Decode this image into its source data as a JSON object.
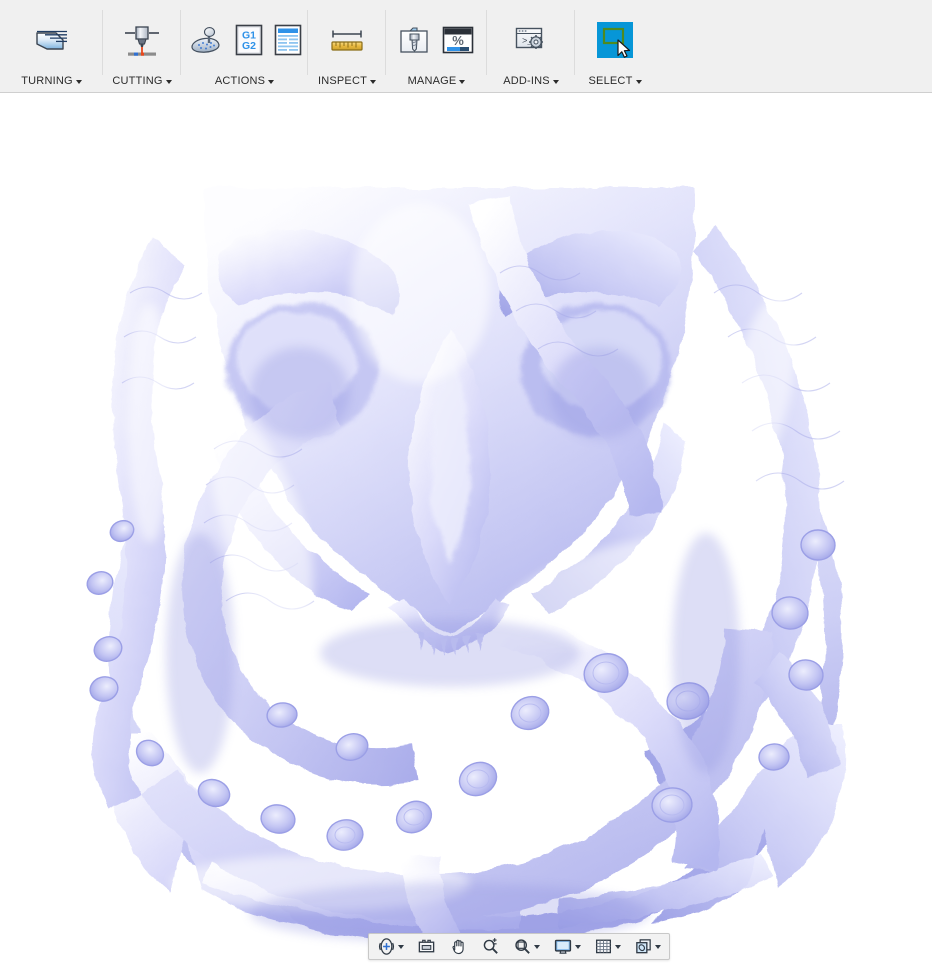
{
  "app": {
    "title": "CAM Workspace",
    "background_color": "#f0f0f0",
    "viewport_color": "#ffffff",
    "accent_color": "#0696d7",
    "model_color_light": "#f2f2ff",
    "model_color_mid": "#ccccf4",
    "model_color_shadow": "#a9acea"
  },
  "ribbon": {
    "groups": [
      {
        "id": "turning",
        "label": "TURNING",
        "has_dropdown": true,
        "icons": [
          {
            "name": "turning-profile-icon",
            "title": "Turning Profile"
          }
        ]
      },
      {
        "id": "cutting",
        "label": "CUTTING",
        "has_dropdown": true,
        "icons": [
          {
            "name": "cutting-jet-icon",
            "title": "Cutting"
          }
        ]
      },
      {
        "id": "actions",
        "label": "ACTIONS",
        "has_dropdown": true,
        "icons": [
          {
            "name": "simulate-icon",
            "title": "Simulate"
          },
          {
            "name": "post-process-g1-g2-icon",
            "title": "Post Process",
            "text_line_1": "G1",
            "text_line_2": "G2"
          },
          {
            "name": "setup-sheet-icon",
            "title": "Setup Sheet"
          }
        ]
      },
      {
        "id": "inspect",
        "label": "INSPECT",
        "has_dropdown": true,
        "icons": [
          {
            "name": "measure-ruler-icon",
            "title": "Measure"
          }
        ]
      },
      {
        "id": "manage",
        "label": "MANAGE",
        "has_dropdown": true,
        "icons": [
          {
            "name": "tool-library-icon",
            "title": "Tool Library"
          },
          {
            "name": "machining-time-percent-icon",
            "title": "Machining Time",
            "glyph": "%"
          }
        ]
      },
      {
        "id": "add-ins",
        "label": "ADD-INS",
        "has_dropdown": true,
        "icons": [
          {
            "name": "scripts-and-addins-icon",
            "title": "Scripts and Add-Ins"
          }
        ]
      },
      {
        "id": "select",
        "label": "SELECT",
        "has_dropdown": true,
        "active": true,
        "icons": [
          {
            "name": "select-cursor-icon",
            "title": "Select"
          }
        ]
      }
    ]
  },
  "viewport": {
    "name": "3d-model-canvas",
    "model_name": "kraken-skull-anchor-relief",
    "description": "Shaded lavender 3D sculpted relief: a horned skull wreathed in tentacles over an anchor"
  },
  "navbar": {
    "items": [
      {
        "name": "orbit-icon",
        "label": "Orbit",
        "has_dropdown": true
      },
      {
        "name": "look-at-icon",
        "label": "Look At",
        "has_dropdown": false
      },
      {
        "name": "pan-hand-icon",
        "label": "Pan",
        "has_dropdown": false
      },
      {
        "name": "zoom-icon",
        "label": "Zoom",
        "has_dropdown": false
      },
      {
        "name": "fit-icon",
        "label": "Fit",
        "has_dropdown": true
      },
      {
        "name": "display-settings-icon",
        "label": "Display Settings",
        "has_dropdown": true
      },
      {
        "name": "grid-snaps-icon",
        "label": "Grid and Snaps",
        "has_dropdown": true
      },
      {
        "name": "viewports-icon",
        "label": "Viewports",
        "has_dropdown": true
      }
    ]
  }
}
